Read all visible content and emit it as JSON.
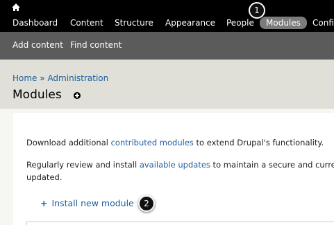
{
  "toolbar": {
    "home_icon": "home-icon",
    "menu": [
      {
        "label": "Dashboard"
      },
      {
        "label": "Content"
      },
      {
        "label": "Structure"
      },
      {
        "label": "Appearance"
      },
      {
        "label": "People"
      },
      {
        "label": "Modules"
      },
      {
        "label": "Confi"
      }
    ],
    "active_item": "Modules",
    "active_color": "#7b7b7b"
  },
  "shortcuts": {
    "items": [
      {
        "label": "Add content"
      },
      {
        "label": "Find content"
      }
    ]
  },
  "callouts": {
    "one": "1",
    "two": "2"
  },
  "header": {
    "breadcrumb": {
      "home": "Home",
      "sep": "»",
      "admin": "Administration"
    },
    "title": "Modules",
    "add_shortcut_icon": "plus-circle-icon"
  },
  "content": {
    "para1": {
      "before": "Download additional ",
      "link": "contributed modules",
      "after": " to extend Drupal's functionality."
    },
    "para2": {
      "before": "Regularly review and install ",
      "link": "available updates",
      "after": " to maintain a secure and curre",
      "line2": "updated."
    },
    "install": {
      "plus": "+",
      "label": "Install new module"
    }
  },
  "colors": {
    "toolbar_bg": "#000000",
    "shortcut_bg": "#5b5b5b",
    "header_bg": "#e0e0d8",
    "link": "#1f5fa0"
  }
}
